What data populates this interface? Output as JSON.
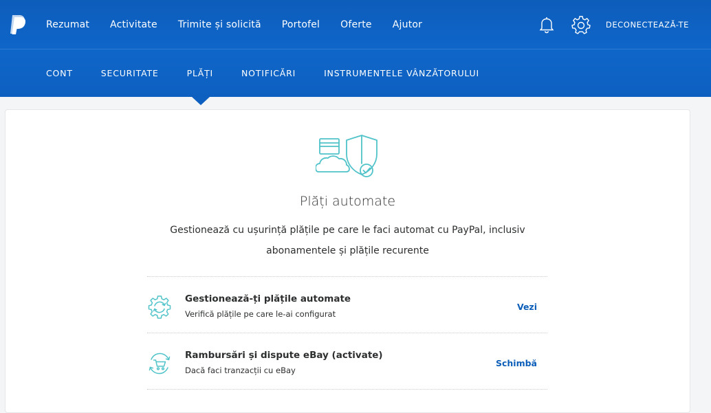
{
  "colors": {
    "header_blue": "#0d5dbb",
    "subnav_blue": "#0f66c9",
    "accent_teal": "#4fc3c9",
    "link_blue": "#0c5eb9"
  },
  "header": {
    "logo_icon": "paypal-logo",
    "nav": [
      "Rezumat",
      "Activitate",
      "Trimite și solicită",
      "Portofel",
      "Oferte",
      "Ajutor"
    ],
    "notifications_icon": "bell-icon",
    "settings_icon": "gear-icon",
    "logout_label": "DECONECTEAZĂ-TE"
  },
  "subnav": {
    "tabs": [
      "CONT",
      "SECURITATE",
      "PLĂȚI",
      "NOTIFICĂRI",
      "INSTRUMENTELE VÂNZĂTORULUI"
    ],
    "active_tab": "PLĂȚI"
  },
  "main": {
    "illustration_icon": "payments-shield-illustration",
    "title": "Plăți automate",
    "description": "Gestionează cu ușurință plățile pe care le faci automat cu PayPal, inclusiv abonamentele și plățile recurente",
    "rows": [
      {
        "icon": "gear-cycle-icon",
        "title": "Gestionează-ți plățile automate",
        "subtitle": "Verifică plățile pe care le-ai configurat",
        "action": "Vezi"
      },
      {
        "icon": "cart-refund-icon",
        "title": "Rambursări și dispute eBay (activate)",
        "subtitle": "Dacă faci tranzacții cu eBay",
        "action": "Schimbă"
      }
    ]
  }
}
